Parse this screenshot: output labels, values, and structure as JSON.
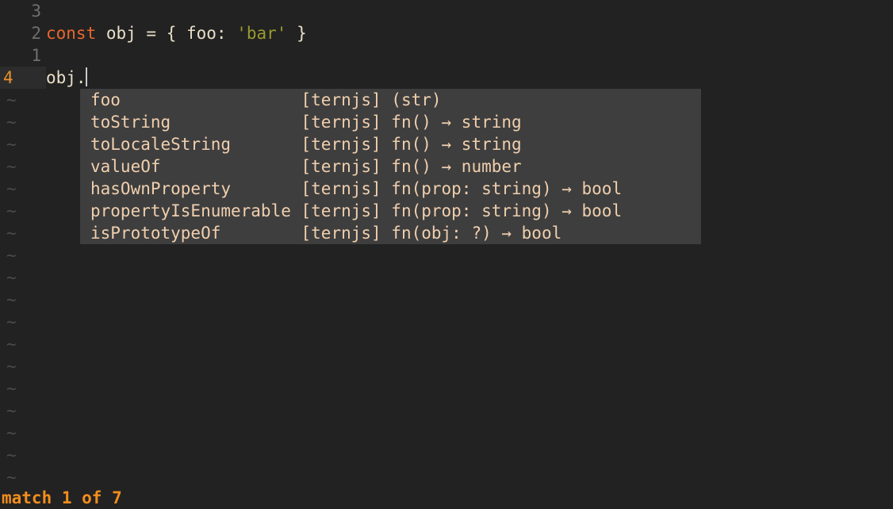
{
  "editor": {
    "background": "#222222",
    "foreground": "#e8dfc8",
    "gutter_color": "#6f6f6f",
    "current_line_number_color": "#e8922c",
    "current_line_gutter_bg": "#2c2c2c",
    "tilde_color": "#4a4a4a",
    "tilde_glyph": "~",
    "cursor_color": "#c8c8c8",
    "lines": [
      {
        "number": "3",
        "current": false,
        "tokens": []
      },
      {
        "number": "2",
        "current": false,
        "tokens": [
          {
            "text": "const",
            "type": "keyword"
          },
          {
            "text": " obj = { foo: ",
            "type": "plain"
          },
          {
            "text": "'bar'",
            "type": "string"
          },
          {
            "text": " }",
            "type": "plain"
          }
        ]
      },
      {
        "number": "1",
        "current": false,
        "tokens": []
      },
      {
        "number": "4",
        "current": true,
        "tokens": [
          {
            "text": "obj.",
            "type": "plain"
          }
        ]
      }
    ],
    "empty_line_count": 18
  },
  "popup": {
    "background": "#3e3e3e",
    "text_color": "#f0cfae",
    "name_column_width": 20,
    "selected_index": 0,
    "items": [
      {
        "name": "foo",
        "doc": "[ternjs] (str)"
      },
      {
        "name": "toString",
        "doc": "[ternjs] fn() → string"
      },
      {
        "name": "toLocaleString",
        "doc": "[ternjs] fn() → string"
      },
      {
        "name": "valueOf",
        "doc": "[ternjs] fn() → number"
      },
      {
        "name": "hasOwnProperty",
        "doc": "[ternjs] fn(prop: string) → bool"
      },
      {
        "name": "propertyIsEnumerable",
        "doc": "[ternjs] fn(prop: string) → bool"
      },
      {
        "name": "isPrototypeOf",
        "doc": "[ternjs] fn(obj: ?) → bool"
      }
    ]
  },
  "statusline": {
    "message": "match 1 of 7",
    "color": "#f28d1e"
  }
}
